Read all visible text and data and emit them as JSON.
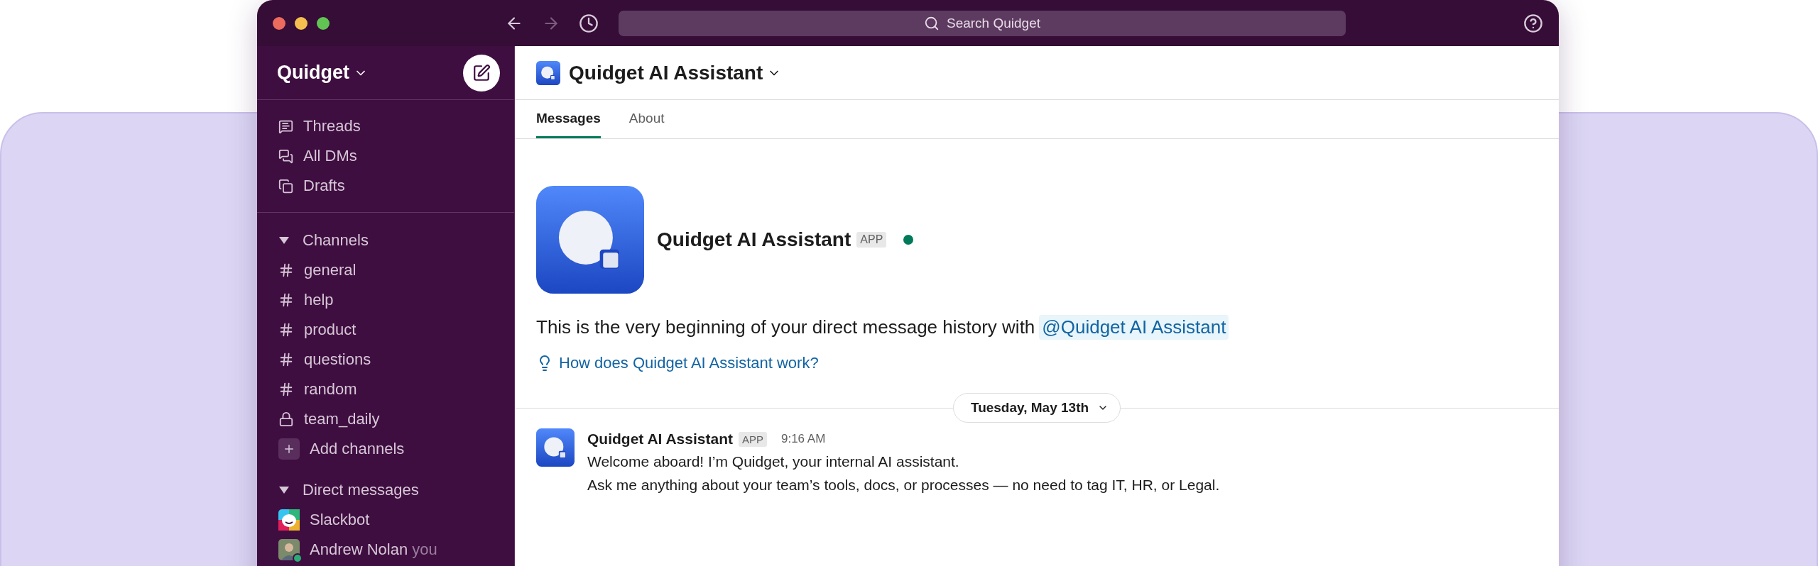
{
  "window": {
    "search_placeholder": "Search Quidget"
  },
  "sidebar": {
    "workspace": "Quidget",
    "nav": [
      {
        "label": "Threads",
        "kind": "threads"
      },
      {
        "label": "All DMs",
        "kind": "dms"
      },
      {
        "label": "Drafts",
        "kind": "drafts"
      }
    ],
    "sections": [
      {
        "title": "Channels",
        "expanded": true,
        "items": [
          {
            "label": "general",
            "kind": "public"
          },
          {
            "label": "help",
            "kind": "public"
          },
          {
            "label": "product",
            "kind": "public"
          },
          {
            "label": "questions",
            "kind": "public"
          },
          {
            "label": "random",
            "kind": "public"
          },
          {
            "label": "team_daily",
            "kind": "private"
          },
          {
            "label": "Add channels",
            "kind": "add"
          }
        ]
      },
      {
        "title": "Direct messages",
        "expanded": true,
        "items": [
          {
            "label": "Slackbot",
            "kind": "bot"
          },
          {
            "label": "Andrew Nolan",
            "kind": "user",
            "suffix": "you",
            "online": true
          }
        ]
      }
    ]
  },
  "channel": {
    "title": "Quidget AI Assistant",
    "tabs": [
      {
        "label": "Messages",
        "selected": true
      },
      {
        "label": "About",
        "selected": false
      }
    ]
  },
  "intro": {
    "name": "Quidget AI Assistant",
    "badge": "APP",
    "online": true,
    "text": "This is the very beginning of your direct message history with",
    "mention": "@Quidget AI Assistant",
    "help_link": "How does Quidget AI Assistant work?"
  },
  "date_divider": "Tuesday, May 13th",
  "messages": [
    {
      "author": "Quidget AI Assistant",
      "badge": "APP",
      "time": "9:16 AM",
      "lines": [
        "Welcome aboard! I’m Quidget, your internal AI assistant.",
        "Ask me anything about your team’s tools, docs, or processes — no need to tag IT, HR, or Legal."
      ]
    }
  ]
}
